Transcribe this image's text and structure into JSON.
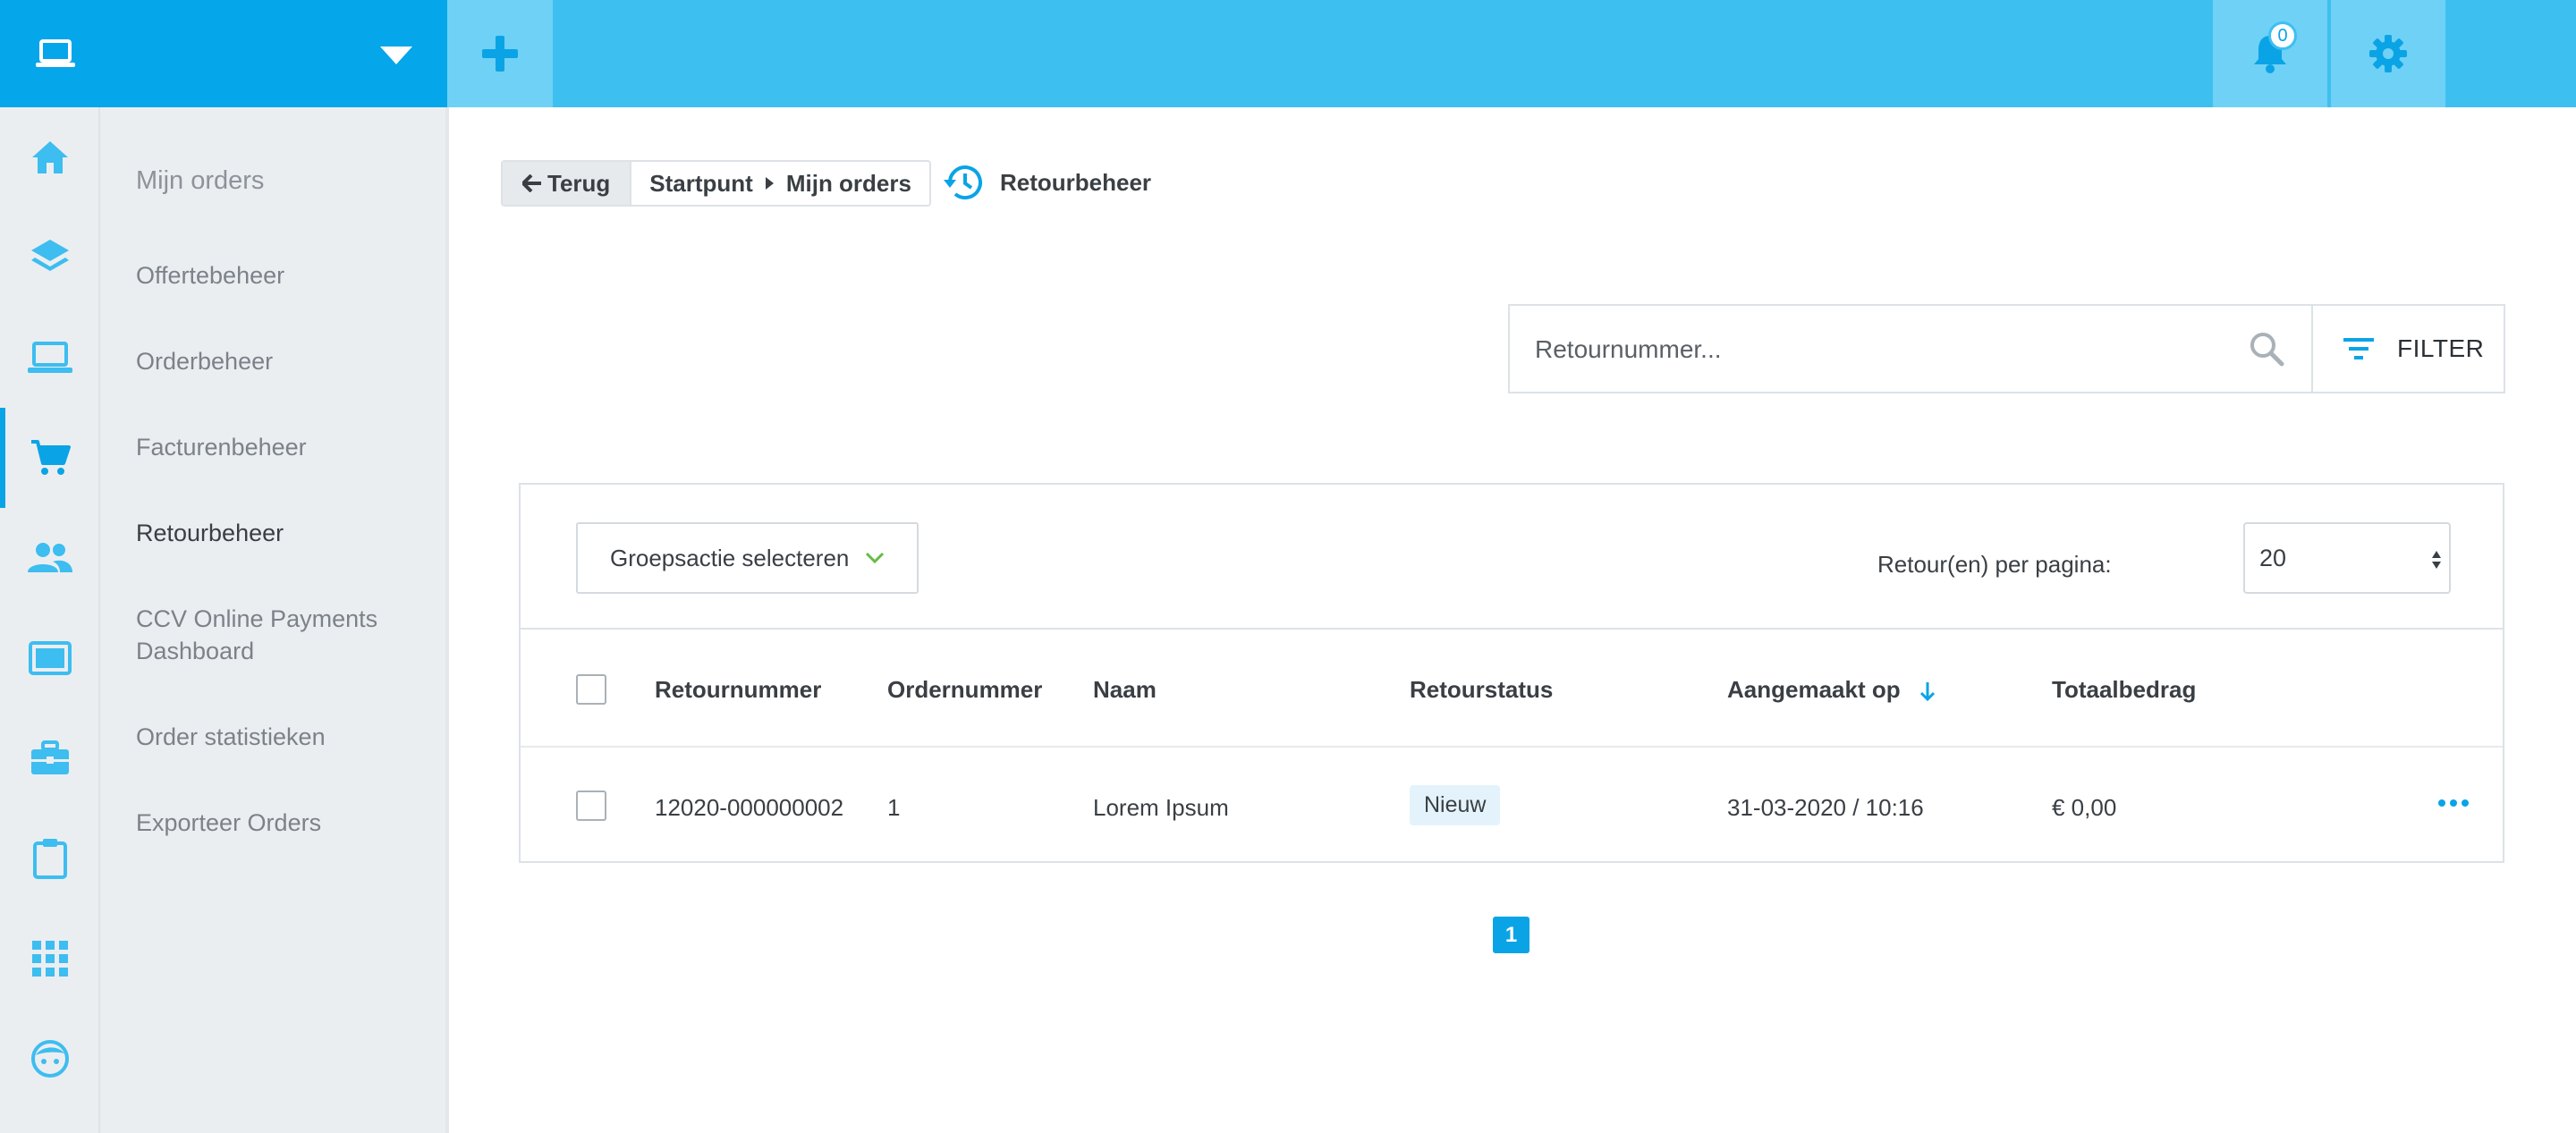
{
  "topbar": {
    "brand_icon": "laptop-icon",
    "add_icon": "plus-icon",
    "notifications": {
      "icon": "bell-icon",
      "count": "0"
    },
    "settings_icon": "gear-icon",
    "colors": {
      "bar": "#3dc0f0",
      "brand": "#05a6ea",
      "button": "#6fd1f5"
    }
  },
  "rail": {
    "items": [
      {
        "icon": "home-icon"
      },
      {
        "icon": "layers-icon"
      },
      {
        "icon": "laptop-icon"
      },
      {
        "icon": "cart-icon",
        "active": true
      },
      {
        "icon": "users-icon"
      },
      {
        "icon": "tablet-icon"
      },
      {
        "icon": "briefcase-icon"
      },
      {
        "icon": "clipboard-icon"
      },
      {
        "icon": "apps-grid-icon"
      },
      {
        "icon": "face-icon"
      }
    ]
  },
  "submenu": {
    "title": "Mijn orders",
    "items": [
      "Offertebeheer",
      "Orderbeheer",
      "Facturenbeheer",
      "Retourbeheer",
      "CCV Online Payments Dashboard",
      "Order statistieken",
      "Exporteer Orders"
    ]
  },
  "breadcrumb": {
    "back_label": "Terug",
    "path": [
      "Startpunt",
      "Mijn orders"
    ]
  },
  "page": {
    "title": "Retourbeheer",
    "icon": "history-icon"
  },
  "search": {
    "placeholder": "Retournummer...",
    "value": ""
  },
  "filter": {
    "label": "FILTER",
    "icon": "filter-icon"
  },
  "toolbar": {
    "group_action_label": "Groepsactie selecteren",
    "per_page_label": "Retour(en) per pagina:",
    "per_page_value": "20"
  },
  "table": {
    "columns": [
      "Retournummer",
      "Ordernummer",
      "Naam",
      "Retourstatus",
      "Aangemaakt op",
      "Totaalbedrag"
    ],
    "sorted_column": "Aangemaakt op",
    "rows": [
      {
        "retournummer": "12020-000000002",
        "ordernummer": "1",
        "naam": "Lorem Ipsum",
        "status": "Nieuw",
        "aangemaakt": "31-03-2020 / 10:16",
        "totaal": "€ 0,00"
      }
    ]
  },
  "pagination": {
    "current": "1"
  },
  "accent": "#0aa4e6"
}
